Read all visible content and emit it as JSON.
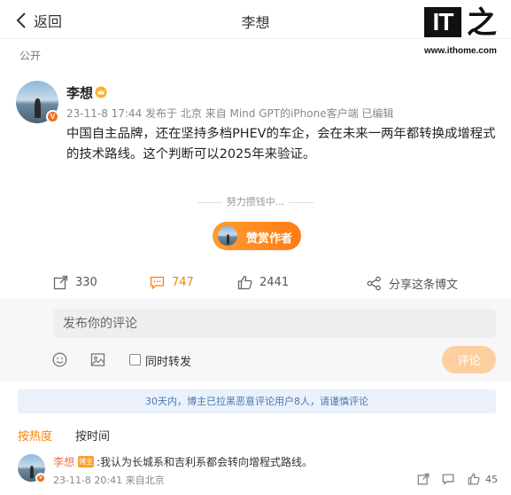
{
  "header": {
    "back_label": "返回",
    "title": "李想"
  },
  "watermark": {
    "logo_text": "IT之家",
    "url": "www.ithome.com"
  },
  "post": {
    "visibility": "公开",
    "author": "李想",
    "meta": "23-11-8 17:44  发布于 北京  来自 Mind GPT的iPhone客户端  已编辑",
    "text": "中国自主品牌，还在坚持多档PHEV的车企，会在未来一两年都转换成增程式的技术路线。这个判断可以2025年来验证。",
    "fundraising_text": "努力攒钱中...",
    "tip_label": "赞赏作者"
  },
  "actions": {
    "reposts": "330",
    "comments": "747",
    "likes": "2441",
    "share_label": "分享这条博文"
  },
  "comment_box": {
    "placeholder": "发布你的评论",
    "repost_label": "同时转发",
    "submit_label": "评论"
  },
  "notice": "30天内，博主已拉黑恶意评论用户8人，请谨慎评论",
  "sort": {
    "hot_label": "按热度",
    "time_label": "按时间"
  },
  "comments": [
    {
      "author": "李想",
      "tag": "博主",
      "text": ":我认为长城系和吉利系都会转向增程式路线。",
      "meta": "23-11-8 20:41  来自北京",
      "likes": "45"
    }
  ],
  "colors": {
    "accent": "#ff8200",
    "link": "#eb7350",
    "notice_bg": "#eaf1fa",
    "notice_text": "#4a78b5",
    "tip_gradient_start": "#ff9d2f",
    "tip_gradient_end": "#ff7b17",
    "submit_disabled": "#fdcf9f"
  },
  "icons": [
    "chevron-left-icon",
    "crown-icon",
    "repost-icon",
    "comment-icon",
    "like-icon",
    "share-icon",
    "emoji-icon",
    "image-icon",
    "checkbox",
    "verified-badge-icon"
  ]
}
